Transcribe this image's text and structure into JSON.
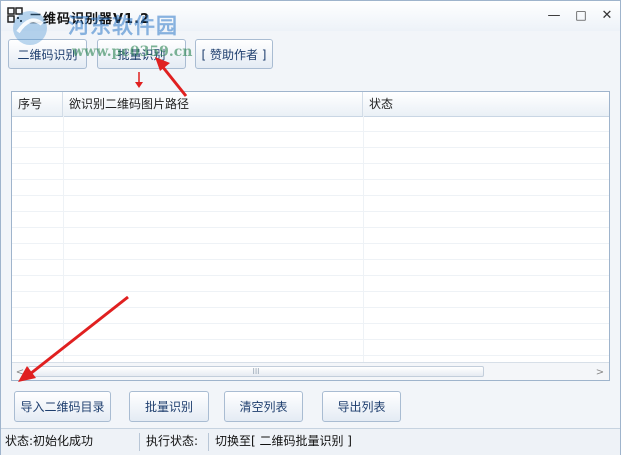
{
  "window": {
    "title": "二维码识别器V1.2",
    "controls": {
      "minimize": "—",
      "maximize": "□",
      "close": "✕"
    }
  },
  "toolbar": {
    "tabs": [
      "二维码识别",
      "批量识别",
      "[ 赞助作者 ]"
    ]
  },
  "table": {
    "columns": [
      "序号",
      "欲识别二维码图片路径",
      "状态"
    ],
    "rows": []
  },
  "scrollbar": {
    "left": "<",
    "right": ">",
    "grip": "III"
  },
  "actions": [
    "导入二维码目录",
    "批量识别",
    "清空列表",
    "导出列表"
  ],
  "status": {
    "init": "状态:初始化成功",
    "exec_label": "执行状态:",
    "exec_value": "切换至[ 二维码批量识别 ]"
  },
  "watermark": {
    "site_name": "河东软件园",
    "url": "www.pc0359.cn"
  },
  "colors": {
    "accent": "#1e3e6e",
    "border": "#9fb4cc",
    "annotation_arrow": "#e02020"
  }
}
